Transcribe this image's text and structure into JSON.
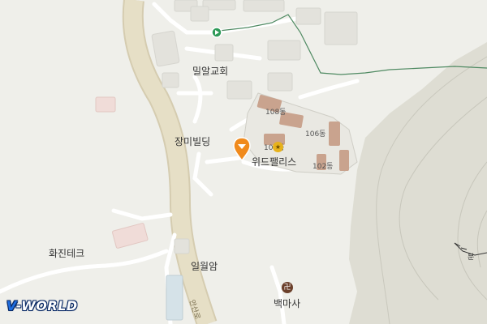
{
  "labels": {
    "church": "밀알교회",
    "jangmi": "장미빌딩",
    "widpalace": "위드팰리스",
    "hwajin": "화진테크",
    "ilwolam": "일월암",
    "baekmasa": "백마사",
    "bldg108": "108동",
    "bldg106": "106동",
    "bldg101": "101동",
    "bldg102": "102동",
    "road": "안산로",
    "trail": "분"
  },
  "logo": {
    "v": "V",
    "rest": "-WORLD"
  },
  "icons": {
    "temple_glyph": "卍",
    "gold_glyph": "★"
  },
  "colors": {
    "background": "#efefea",
    "road": "#e4dcc4",
    "mountain": "#dddcd2",
    "trail": "#4f8a62",
    "building": "#c9a38e",
    "pin": "#f08a1c"
  }
}
